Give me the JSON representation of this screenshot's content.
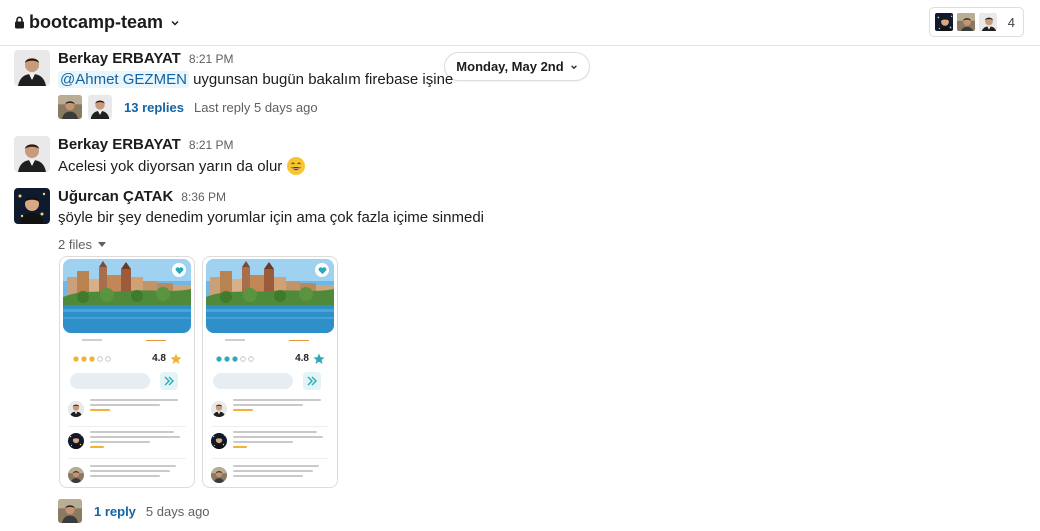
{
  "header": {
    "channel_name": "bootcamp-team",
    "member_count": "4",
    "icons": [
      "lock-icon",
      "chevron-down-icon"
    ]
  },
  "messages": [
    {
      "author": "Berkay ERBAYAT",
      "time": "8:21 PM",
      "mention": "@Ahmet GEZMEN",
      "text": "uygunsan bugün bakalım firebase işine",
      "thread": {
        "replies": "13 replies",
        "last_reply": "Last reply 5 days ago"
      }
    },
    {
      "author": "Berkay ERBAYAT",
      "time": "8:21 PM",
      "text": "Acelesi yok diyorsan yarın da olur",
      "emoji": "😄"
    },
    {
      "author": "Uğurcan ÇATAK",
      "time": "8:36 PM",
      "text": "şöyle bir şey denedim yorumlar için ama çok fazla içime sinmedi",
      "files_label": "2 files",
      "files": [
        {
          "rating": "4.8",
          "star_color": "#f2b233",
          "accent": "#e79a38"
        },
        {
          "rating": "4.8",
          "star_color": "#2aa9b8",
          "accent": "#e79a38"
        }
      ],
      "thread": {
        "replies": "1 reply",
        "last_reply": "5 days ago"
      }
    }
  ],
  "date_divider": "Monday, May 2nd",
  "colors": {
    "link": "#1264a3",
    "mention_bg": "#e8f5fa",
    "text": "#1d1c1d",
    "muted": "#616061"
  }
}
